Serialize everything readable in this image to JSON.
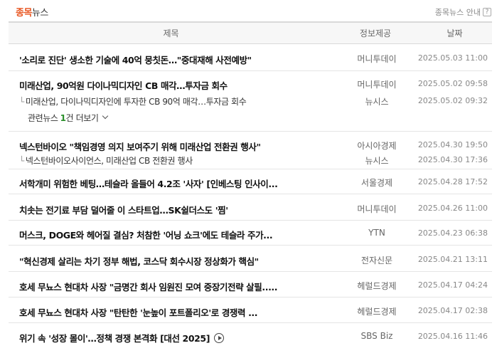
{
  "header": {
    "title_highlight": "종목",
    "title_rest": "뉴스",
    "guide_label": "종목뉴스 안내",
    "guide_icon": "?"
  },
  "columns": {
    "title": "제목",
    "source": "정보제공",
    "date": "날짜"
  },
  "items": [
    {
      "title": "'소리로 진단' 생소한 기술에 40억 뭉칫돈…\"중대재해 사전예방\"",
      "source": "머니투데이",
      "date": "2025.05.03 11:00"
    },
    {
      "title": "미래산업, 90억원 다이나믹디자인 CB 매각…투자금 회수",
      "source": "머니투데이",
      "date": "2025.05.02 09:58"
    },
    {
      "title": "미래산업, 다이나믹디자인에 투자한 CB 90억 매각…투자금 회수",
      "source": "뉴시스",
      "date": "2025.05.02 09:32"
    },
    {
      "title": "넥스턴바이오 \"책임경영 의지 보여주기 위해 미래산업 전환권 행사\"",
      "source": "아시아경제",
      "date": "2025.04.30 19:50"
    },
    {
      "title": "넥스턴바이오사이언스, 미래산업 CB 전환권 행사",
      "source": "뉴시스",
      "date": "2025.04.30 17:36"
    },
    {
      "title": "서학개미 위험한 베팅…테슬라 올들어 4.2조 '사자' [인베스팅 인사이...",
      "source": "서울경제",
      "date": "2025.04.28 17:52"
    },
    {
      "title": "치솟는 전기료 부담 덜어줄 이 스타트업…SK쉴더스도 '찜'",
      "source": "머니투데이",
      "date": "2025.04.26 11:00"
    },
    {
      "title": "머스크, DOGE와 헤어질 결심? 처참한 '어닝 쇼크'에도 테슬라 주가...",
      "source": "YTN",
      "date": "2025.04.23 06:38"
    },
    {
      "title": "\"혁신경제 살리는 차기 정부 해법, 코스닥 회수시장 정상화가 핵심\"",
      "source": "전자신문",
      "date": "2025.04.21 13:11"
    },
    {
      "title": "호세 무뇨스 현대차 사장 \"금명간 회사 임원진 모여 중장기전략 살필.....",
      "source": "헤럴드경제",
      "date": "2025.04.17 04:24"
    },
    {
      "title": "호세 무뇨스 현대차 사장 \"탄탄한 '눈높이 포트폴리오'로 경쟁력 ...",
      "source": "헤럴드경제",
      "date": "2025.04.17 02:38"
    },
    {
      "title": "위기 속 '성장 몰이'…정책 경쟁 본격화 [대선 2025]",
      "source": "SBS Biz",
      "date": "2025.04.16 11:46"
    }
  ],
  "related": {
    "prefix": "관련뉴스",
    "count": "1",
    "suffix": "건 더보기"
  },
  "icons": {
    "branch": "└",
    "play": "play-icon",
    "chevron": "chevron-down-icon"
  },
  "colors": {
    "accent": "#e8541e",
    "count": "#2a8f2a"
  }
}
